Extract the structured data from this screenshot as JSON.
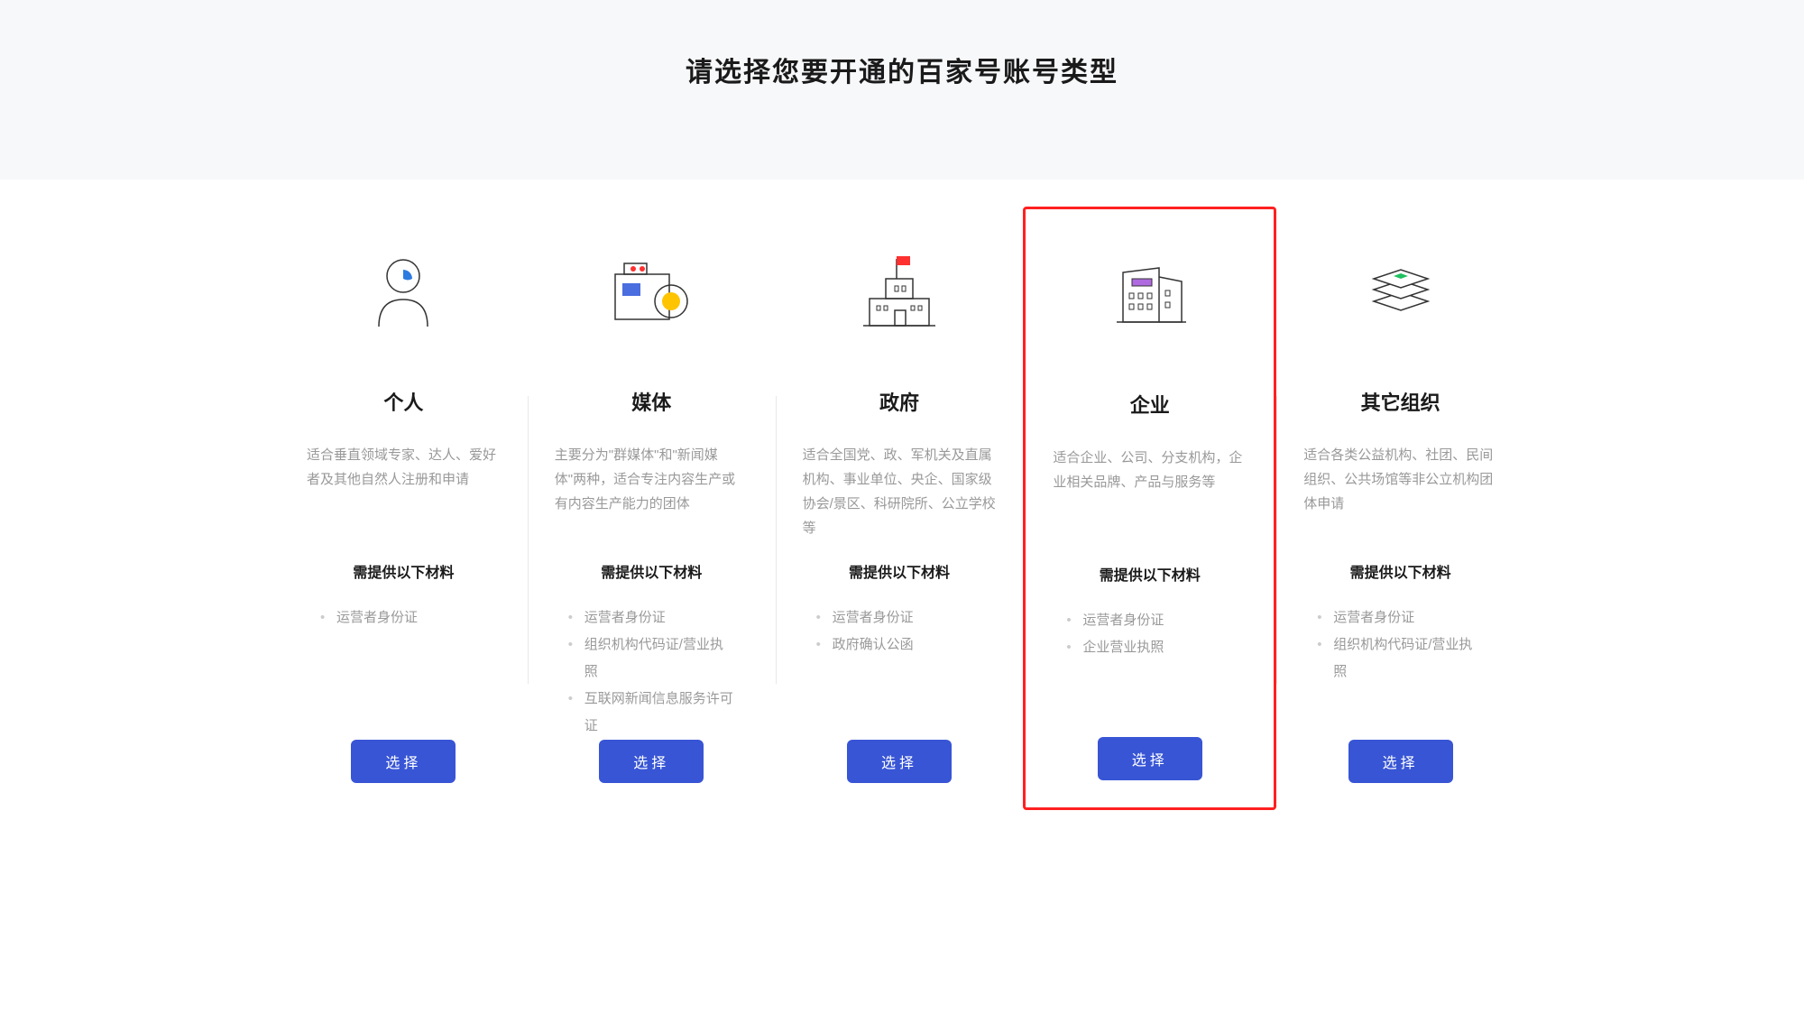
{
  "header": {
    "title": "请选择您要开通的百家号账号类型"
  },
  "cards": [
    {
      "title": "个人",
      "description": "适合垂直领域专家、达人、爱好者及其他自然人注册和申请",
      "materialsTitle": "需提供以下材料",
      "materials": [
        "运营者身份证"
      ],
      "button": "选择",
      "highlighted": false
    },
    {
      "title": "媒体",
      "description": "主要分为\"群媒体\"和\"新闻媒体\"两种，适合专注内容生产或有内容生产能力的团体",
      "materialsTitle": "需提供以下材料",
      "materials": [
        "运营者身份证",
        "组织机构代码证/营业执照",
        "互联网新闻信息服务许可证"
      ],
      "button": "选择",
      "highlighted": false
    },
    {
      "title": "政府",
      "description": "适合全国党、政、军机关及直属机构、事业单位、央企、国家级协会/景区、科研院所、公立学校等",
      "materialsTitle": "需提供以下材料",
      "materials": [
        "运营者身份证",
        "政府确认公函"
      ],
      "button": "选择",
      "highlighted": false
    },
    {
      "title": "企业",
      "description": "适合企业、公司、分支机构，企业相关品牌、产品与服务等",
      "materialsTitle": "需提供以下材料",
      "materials": [
        "运营者身份证",
        "企业营业执照"
      ],
      "button": "选择",
      "highlighted": true
    },
    {
      "title": "其它组织",
      "description": "适合各类公益机构、社团、民间组织、公共场馆等非公立机构团体申请",
      "materialsTitle": "需提供以下材料",
      "materials": [
        "运营者身份证",
        "组织机构代码证/营业执照"
      ],
      "button": "选择",
      "highlighted": false
    }
  ]
}
